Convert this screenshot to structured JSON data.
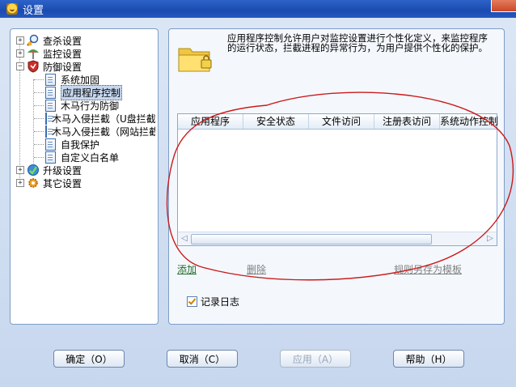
{
  "window": {
    "title": "设置"
  },
  "tree": {
    "items": [
      {
        "label": "查杀设置",
        "icon": "scan-settings-icon",
        "expanded": false
      },
      {
        "label": "监控设置",
        "icon": "monitor-settings-icon",
        "expanded": false
      },
      {
        "label": "防御设置",
        "icon": "defense-settings-icon",
        "expanded": true,
        "children": [
          "系统加固",
          "应用程序控制",
          "木马行为防御",
          "木马入侵拦截（U盘拦截",
          "木马入侵拦截（网站拦截",
          "自我保护",
          "自定义白名单"
        ],
        "selected_child": "应用程序控制"
      },
      {
        "label": "升级设置",
        "icon": "update-settings-icon",
        "expanded": false
      },
      {
        "label": "其它设置",
        "icon": "other-settings-icon",
        "expanded": false
      }
    ]
  },
  "main": {
    "description": "应用程序控制允许用户对监控设置进行个性化定义，来监控程序的运行状态，拦截进程的异常行为，为用户提供个性化的保护。",
    "table": {
      "columns": [
        "应用程序",
        "安全状态",
        "文件访问",
        "注册表访问",
        "系统动作控制"
      ]
    },
    "actions": {
      "add": "添加",
      "delete": "删除",
      "save_template": "规则另存为模板"
    },
    "log_checkbox": {
      "label": "记录日志",
      "checked": true
    }
  },
  "buttons": {
    "ok": "确定（O）",
    "cancel": "取消（C）",
    "apply": "应用（A）",
    "help": "帮助（H）"
  },
  "colors": {
    "accent": "#2458c0",
    "annotation": "#cc1a1a",
    "link_green": "#246b2a"
  }
}
